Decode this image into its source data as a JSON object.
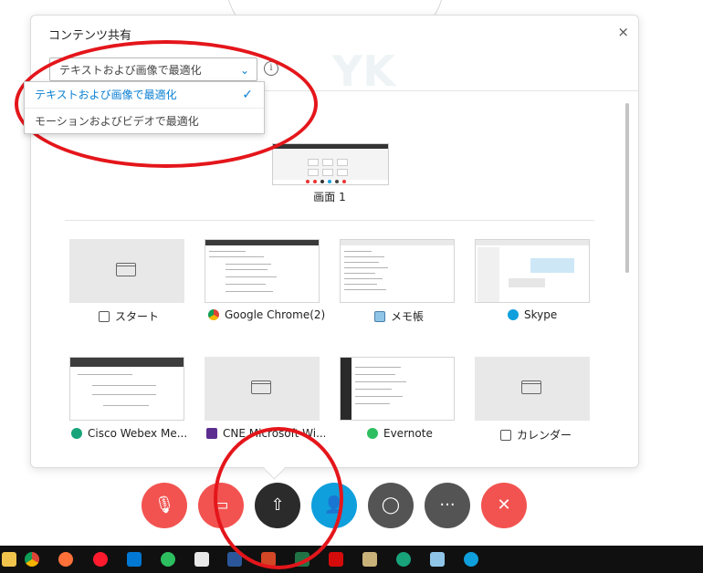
{
  "panel": {
    "title": "コンテンツ共有",
    "close_glyph": "×",
    "watermark": "YK",
    "optimize_selected": "テキストおよび画像で最適化",
    "info_glyph": "i"
  },
  "dropdown": {
    "options": [
      {
        "label": "テキストおよび画像で最適化",
        "selected": true
      },
      {
        "label": "モーションおよびビデオで最適化",
        "selected": false
      }
    ],
    "check_glyph": "✓"
  },
  "screen": {
    "label": "画面 1"
  },
  "apps": [
    {
      "label": "スタート",
      "icon": "window-icon",
      "thumb": "blank"
    },
    {
      "label": "Google Chrome(2)",
      "icon": "chrome-icon",
      "thumb": "browser"
    },
    {
      "label": "メモ帳",
      "icon": "notepad-icon",
      "thumb": "document"
    },
    {
      "label": "Skype",
      "icon": "skype-icon",
      "thumb": "chat"
    },
    {
      "label": "Cisco Webex Me...",
      "icon": "webex-icon",
      "thumb": "dialog"
    },
    {
      "label": "CNE Microsoft Wi...",
      "icon": "cne-icon",
      "thumb": "blank"
    },
    {
      "label": "Evernote",
      "icon": "evernote-icon",
      "thumb": "editor"
    },
    {
      "label": "カレンダー",
      "icon": "window-icon",
      "thumb": "blank"
    }
  ],
  "controls": {
    "mute_glyph": "🎙",
    "video_glyph": "▭",
    "share_glyph": "⇧",
    "participants_glyph": "👤",
    "chat_glyph": "◯",
    "more_glyph": "···",
    "end_glyph": "✕"
  },
  "colors": {
    "accent": "#0a7fd4",
    "control_red": "#f25350",
    "control_dark": "#2b2b2b",
    "control_gray": "#545454",
    "control_blue": "#0f9fdc",
    "annotation_red": "#e4161b",
    "taskbar": "#101010"
  },
  "taskbar": {
    "icons": [
      "folder-icon",
      "chrome-icon",
      "firefox-icon",
      "opera-icon",
      "outlook-icon",
      "evernote-icon",
      "calculator-icon",
      "word-icon",
      "powerpoint-icon",
      "excel-icon",
      "acrobat-icon",
      "tools-icon",
      "webex-icon",
      "notepad-icon",
      "skype-icon"
    ]
  }
}
